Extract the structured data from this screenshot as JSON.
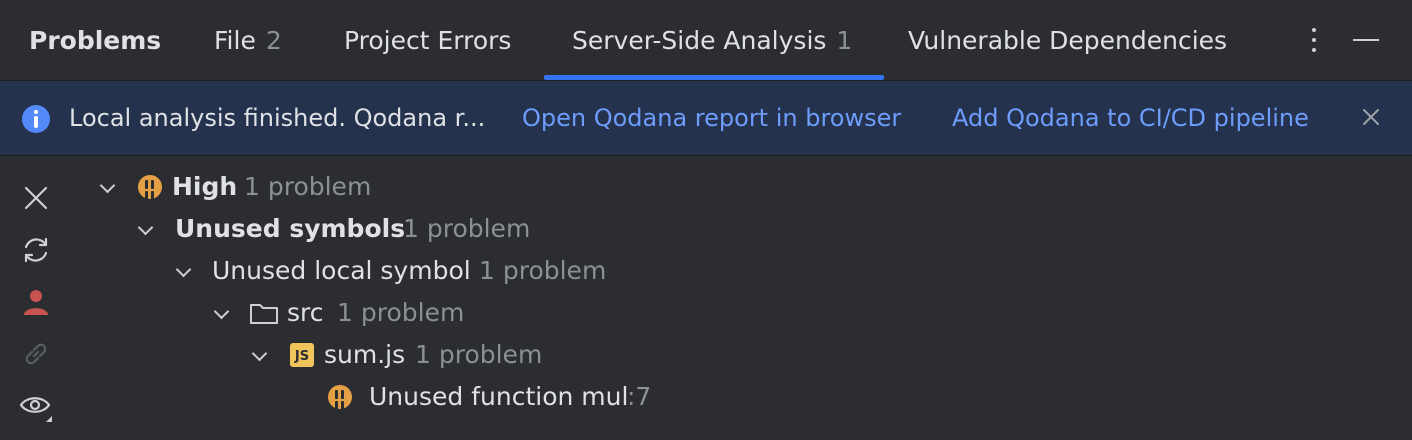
{
  "tabs": {
    "title": "Problems",
    "items": [
      {
        "label": "File",
        "count": "2"
      },
      {
        "label": "Project Errors",
        "count": ""
      },
      {
        "label": "Server-Side Analysis",
        "count": "1"
      },
      {
        "label": "Vulnerable Dependencies",
        "count": ""
      }
    ],
    "active": "Server-Side Analysis"
  },
  "banner": {
    "icon": "info-icon",
    "text": "Local analysis finished. Qodana r...",
    "link_open": "Open Qodana report in browser",
    "link_add": "Add Qodana to CI/CD pipeline",
    "close_icon": "close-icon"
  },
  "toolbar": {
    "icons": [
      "close-icon",
      "refresh-icon",
      "user-icon",
      "link-icon",
      "eye-icon"
    ]
  },
  "tree": {
    "severity": {
      "label": "High",
      "count": "1 problem"
    },
    "group": {
      "label": "Unused symbols",
      "count": "1 problem"
    },
    "inspection": {
      "label": "Unused local symbol",
      "count": "1 problem"
    },
    "folder": {
      "label": "src",
      "count": "1 problem"
    },
    "file": {
      "label": "sum.js",
      "count": "1 problem",
      "icon_text": "JS"
    },
    "problem": {
      "label": "Unused function mul",
      "line": ":7"
    }
  },
  "colors": {
    "background": "#2b2d30",
    "accent": "#3574f0",
    "banner": "#25324d",
    "link": "#6d9cfa",
    "warning": "#e5a045",
    "user": "#c75450"
  }
}
